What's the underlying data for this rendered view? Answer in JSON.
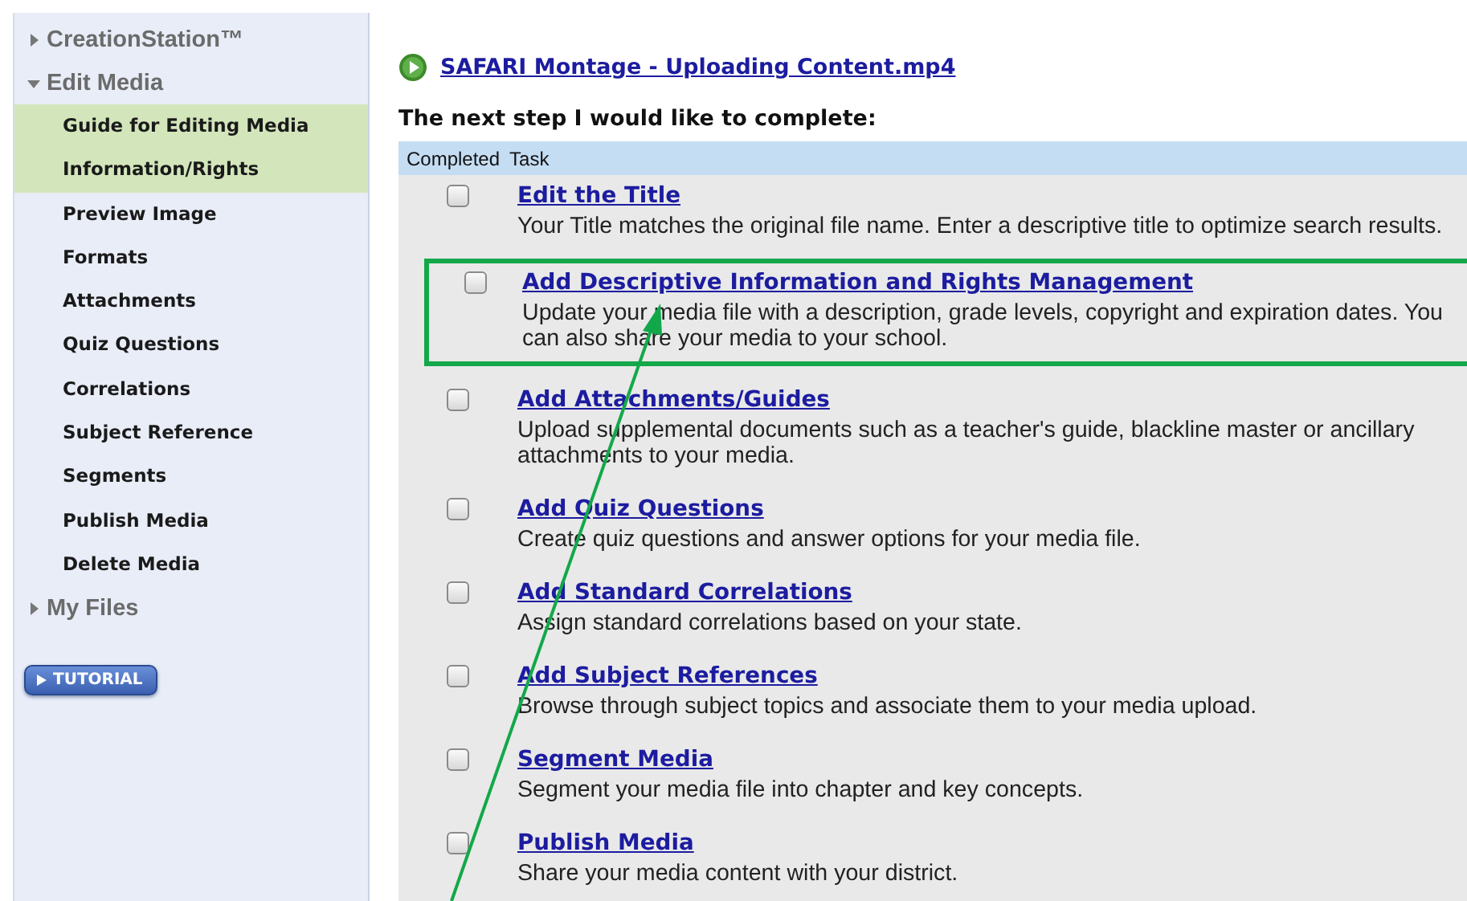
{
  "sidebar": {
    "items": [
      {
        "label": "CreationStation™",
        "expanded": false
      },
      {
        "label": "Edit Media",
        "expanded": true,
        "children": [
          {
            "label": "Guide for Editing Media",
            "selected": true
          },
          {
            "label": "Information/Rights",
            "selected": true
          },
          {
            "label": "Preview Image",
            "selected": false
          },
          {
            "label": "Formats",
            "selected": false
          },
          {
            "label": "Attachments",
            "selected": false
          },
          {
            "label": "Quiz Questions",
            "selected": false
          },
          {
            "label": "Correlations",
            "selected": false
          },
          {
            "label": "Subject Reference",
            "selected": false
          },
          {
            "label": "Segments",
            "selected": false
          },
          {
            "label": "Publish Media",
            "selected": false
          },
          {
            "label": "Delete Media",
            "selected": false
          }
        ]
      },
      {
        "label": "My Files",
        "expanded": false
      }
    ],
    "button": "TUTORIAL"
  },
  "media_link": "SAFARI Montage - Uploading Content.mp4",
  "heading": "The next step I would like to complete:",
  "table": {
    "columns": [
      "Completed",
      "Task"
    ],
    "rows": [
      {
        "checked": false,
        "highlighted": false,
        "title": "Edit the Title",
        "description": "Your Title matches the original file name. Enter a descriptive title to optimize search results."
      },
      {
        "checked": false,
        "highlighted": true,
        "title": "Add Descriptive Information and Rights Management",
        "description": "Update your media file with a description, grade levels, copyright and expiration dates. You can also share your media to your school."
      },
      {
        "checked": false,
        "highlighted": false,
        "title": "Add Attachments/Guides",
        "description": "Upload supplemental documents such as a teacher's guide, blackline master or ancillary attachments to your media."
      },
      {
        "checked": false,
        "highlighted": false,
        "title": "Add Quiz Questions",
        "description": "Create quiz questions and answer options for your media file."
      },
      {
        "checked": false,
        "highlighted": false,
        "title": "Add Standard Correlations",
        "description": "Assign standard correlations based on your state."
      },
      {
        "checked": false,
        "highlighted": false,
        "title": "Add Subject References",
        "description": "Browse through subject topics and associate them to your media upload."
      },
      {
        "checked": false,
        "highlighted": false,
        "title": "Segment Media",
        "description": "Segment your media file into chapter and key concepts."
      },
      {
        "checked": false,
        "highlighted": false,
        "title": "Publish Media",
        "description": "Share your media content with your district."
      }
    ]
  },
  "pointer_arrow": true
}
